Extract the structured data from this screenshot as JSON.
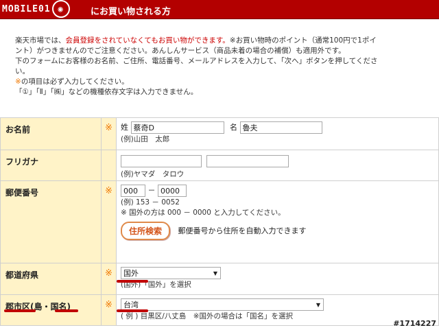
{
  "header": {
    "logo_text": "MOBILE01",
    "logo_icon": "speech-bubble-icon",
    "title": "にお買い物される方"
  },
  "intro": {
    "line1_a": "楽天市場では、",
    "line1_red": "会員登録をされていなくてもお買い物ができます。",
    "line1_b": "※お買い物時のポイント（通常100円で1ポイ",
    "line2": "ント）がつきませんのでご注意ください。あんしんサービス（商品未着の場合の補償）も適用外です。",
    "line3": "下のフォームにお客様のお名前、ご住所、電話番号、メールアドレスを入力して、「次へ」ボタンを押してくださ",
    "line4": "い。",
    "line5_mark": "※",
    "line5": "の項目は必ず入力してください。",
    "line6": "「①」「Ⅱ」「㈱」などの機種依存文字は入力できません。"
  },
  "form": {
    "required_mark": "※",
    "name": {
      "label": "お名前",
      "sei_label": "姓",
      "sei_value": "蔡奇D",
      "mei_label": "名",
      "mei_value": "魯夫",
      "example": "(例)山田　太郎"
    },
    "kana": {
      "label": "フリガナ",
      "example": "(例)ヤマダ　タロウ"
    },
    "zip": {
      "label": "郵便番号",
      "first": "000",
      "dash": "－",
      "second": "0000",
      "example": "(例) 153 － 0052",
      "overseas_note": "※ 国外の方は 000 － 0000 と入力してください。",
      "button": "住所検索",
      "button_note": "郵便番号から住所を自動入力できます"
    },
    "pref": {
      "label": "都道府県",
      "selected": "国外",
      "note": "(国外)「国外」を選択"
    },
    "city": {
      "label": "郡市区(島・国名)",
      "selected": "台湾",
      "note": "( 例 ) 目黒区/八丈島　※国外の場合は「国名」を選択"
    }
  },
  "watermark": "#1714227",
  "colors": {
    "header": "#b30000",
    "label_bg": "#fff3c8",
    "required": "#f07800",
    "highlight": "#c00000"
  }
}
